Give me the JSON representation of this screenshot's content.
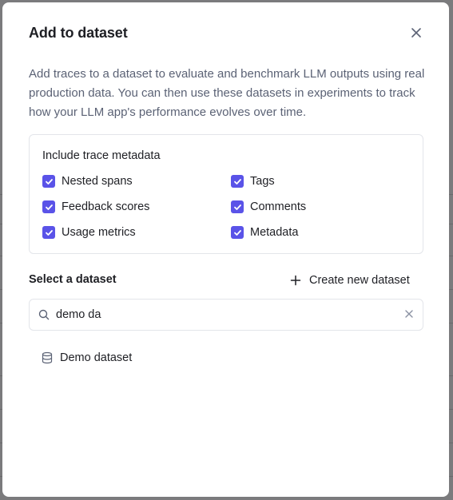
{
  "dialog": {
    "title": "Add to dataset",
    "description": "Add traces to a dataset to evaluate and benchmark LLM outputs using real production data. You can then use these datasets in experiments to track how your LLM app's performance evolves over time."
  },
  "metadata": {
    "title": "Include trace metadata",
    "options": [
      {
        "label": "Nested spans",
        "checked": true
      },
      {
        "label": "Tags",
        "checked": true
      },
      {
        "label": "Feedback scores",
        "checked": true
      },
      {
        "label": "Comments",
        "checked": true
      },
      {
        "label": "Usage metrics",
        "checked": true
      },
      {
        "label": "Metadata",
        "checked": true
      }
    ]
  },
  "dataset_select": {
    "label": "Select a dataset",
    "create_label": "Create new dataset",
    "search_value": "demo da",
    "results": [
      "Demo dataset"
    ]
  },
  "colors": {
    "accent": "#5a53e8",
    "text": "#1e1f24",
    "muted_text": "#5b6275",
    "border": "#e3e5ea"
  },
  "icons": [
    "close-icon",
    "check-icon",
    "plus-icon",
    "search-icon",
    "clear-icon",
    "database-icon"
  ]
}
